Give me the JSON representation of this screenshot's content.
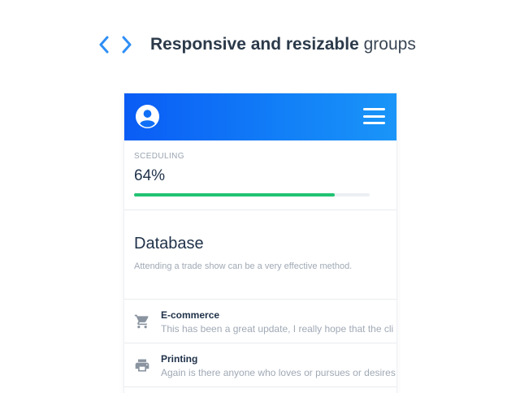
{
  "header": {
    "title_bold": "Responsive and resizable",
    "title_rest": "groups"
  },
  "icons": {
    "prev": "chevron-left-icon",
    "next": "chevron-right-icon",
    "avatar": "account-circle-icon",
    "menu": "hamburger-menu-icon",
    "cart": "shopping-cart-icon",
    "printer": "printer-icon"
  },
  "colors": {
    "accent_blue": "#1280f7",
    "progress_green": "#21c372",
    "arrow_blue": "#2f8ff5"
  },
  "progress": {
    "label": "SCEDULING",
    "value_text": "64%",
    "fraction": 0.85
  },
  "database": {
    "title": "Database",
    "description": "Attending a trade show can be a very effective method."
  },
  "list": [
    {
      "title": "E-commerce",
      "subtitle": "This has been a great update, I really hope that the cli",
      "icon": "shopping-cart-icon"
    },
    {
      "title": "Printing",
      "subtitle": "Again is there anyone who loves or pursues or desires",
      "icon": "printer-icon"
    }
  ]
}
